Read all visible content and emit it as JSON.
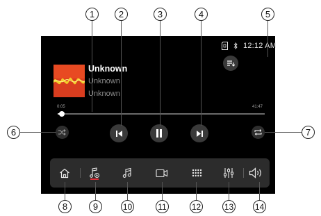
{
  "status_bar": {
    "time": "12:12 AM",
    "icons": [
      "sd-card-icon",
      "bluetooth-icon"
    ]
  },
  "track": {
    "title": "Unknown",
    "artist": "Unknown",
    "album": "Unknown"
  },
  "progress": {
    "elapsed": "0:05",
    "total": "41:47",
    "fraction": 0.02
  },
  "controls": [
    "shuffle-icon",
    "previous-icon",
    "pause-icon",
    "next-icon",
    "repeat-icon",
    "playlist-icon"
  ],
  "dock": [
    "home-icon",
    "music-source-icon",
    "music-icon",
    "video-icon",
    "apps-grid-icon",
    "equalizer-icon",
    "volume-icon"
  ],
  "callouts": [
    "1",
    "2",
    "3",
    "4",
    "5",
    "6",
    "7",
    "8",
    "9",
    "10",
    "11",
    "12",
    "13",
    "14"
  ],
  "colors": {
    "screen_bg": "#000000",
    "dock_bg": "#2c2c2c",
    "button_bg": "#3a3a3a",
    "active_indicator": "#e0313a"
  }
}
